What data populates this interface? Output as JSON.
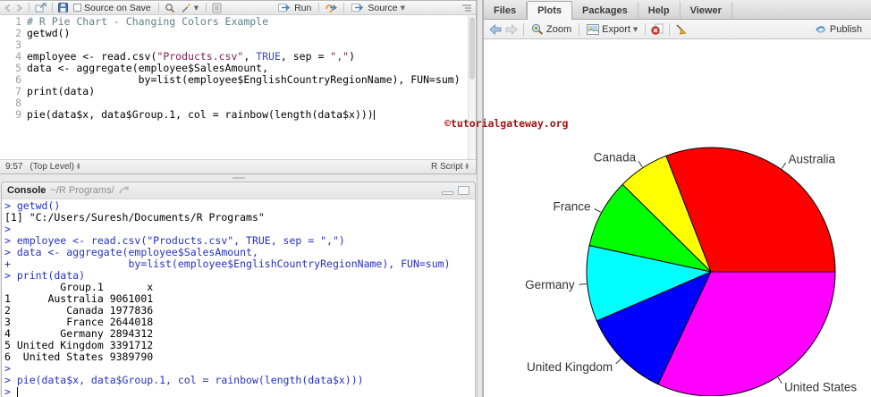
{
  "editor": {
    "toolbar": {
      "source_on_save_label": "Source on Save",
      "run_label": "Run",
      "source_label": "Source"
    },
    "code_lines": [
      [
        {
          "t": "# R Pie Chart - Changing Colors Example",
          "c": "comment"
        }
      ],
      [
        {
          "t": "getwd()",
          "c": "plain"
        }
      ],
      [],
      [
        {
          "t": "employee <- read.csv(",
          "c": "plain"
        },
        {
          "t": "\"Products.csv\"",
          "c": "string"
        },
        {
          "t": ", ",
          "c": "plain"
        },
        {
          "t": "TRUE",
          "c": "keyword"
        },
        {
          "t": ", sep = ",
          "c": "plain"
        },
        {
          "t": "\",\"",
          "c": "string"
        },
        {
          "t": ")",
          "c": "plain"
        }
      ],
      [
        {
          "t": "data <- aggregate(employee$SalesAmount,",
          "c": "plain"
        }
      ],
      [
        {
          "t": "                  by=list(employee$EnglishCountryRegionName), FUN=sum)",
          "c": "plain"
        }
      ],
      [
        {
          "t": "print(data)",
          "c": "plain"
        }
      ],
      [],
      [
        {
          "t": "pie(data$x, data$Group.1, col = rainbow(length(data$x)))",
          "c": "plain"
        }
      ]
    ],
    "cursor_line": 9,
    "status": {
      "position": "9:57",
      "scope": "(Top Level)",
      "mode": "R Script"
    }
  },
  "console": {
    "title": "Console",
    "path": "~/R Programs/",
    "lines": [
      {
        "t": "> getwd()",
        "c": "input"
      },
      {
        "t": "[1] \"C:/Users/Suresh/Documents/R Programs\"",
        "c": "output"
      },
      {
        "t": ">",
        "c": "input"
      },
      {
        "t": "> employee <- read.csv(\"Products.csv\", TRUE, sep = \",\")",
        "c": "input"
      },
      {
        "t": "> data <- aggregate(employee$SalesAmount,",
        "c": "input"
      },
      {
        "t": "+                   by=list(employee$EnglishCountryRegionName), FUN=sum)",
        "c": "input"
      },
      {
        "t": "> print(data)",
        "c": "input"
      },
      {
        "t": "         Group.1       x",
        "c": "output"
      },
      {
        "t": "1      Australia 9061001",
        "c": "output"
      },
      {
        "t": "2         Canada 1977836",
        "c": "output"
      },
      {
        "t": "3         France 2644018",
        "c": "output"
      },
      {
        "t": "4        Germany 2894312",
        "c": "output"
      },
      {
        "t": "5 United Kingdom 3391712",
        "c": "output"
      },
      {
        "t": "6  United States 9389790",
        "c": "output"
      },
      {
        "t": ">",
        "c": "input"
      },
      {
        "t": "> pie(data$x, data$Group.1, col = rainbow(length(data$x)))",
        "c": "input"
      },
      {
        "t": ">",
        "c": "input"
      }
    ]
  },
  "plots_pane": {
    "tabs": [
      "Files",
      "Plots",
      "Packages",
      "Help",
      "Viewer"
    ],
    "active_tab": "Plots",
    "toolbar": {
      "zoom_label": "Zoom",
      "export_label": "Export",
      "publish_label": "Publish"
    }
  },
  "watermark": "©tutorialgateway.org",
  "chart_data": {
    "type": "pie",
    "categories": [
      "Australia",
      "Canada",
      "France",
      "Germany",
      "United Kingdom",
      "United States"
    ],
    "values": [
      9061001,
      1977836,
      2644018,
      2894312,
      3391712,
      9389790
    ],
    "colors": [
      "#FF0000",
      "#FFFF00",
      "#00FF00",
      "#00FFFF",
      "#0000FF",
      "#FF00FF"
    ],
    "title": "",
    "start_angle_deg": 0,
    "direction": "counterclockwise",
    "labels_shown": true,
    "legend_position": "none"
  }
}
